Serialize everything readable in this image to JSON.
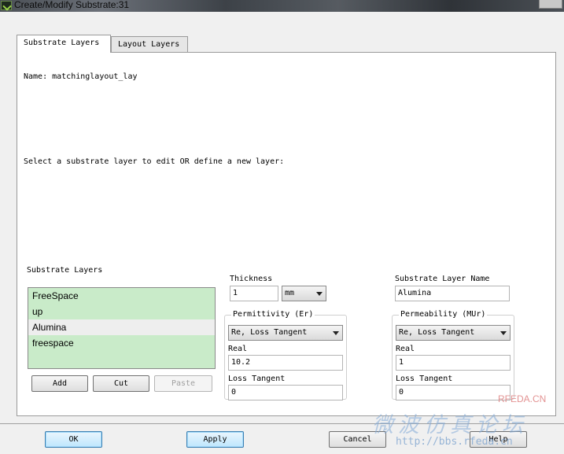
{
  "window": {
    "title": "Create/Modify Substrate:31"
  },
  "tabs": [
    {
      "label": "Substrate Layers",
      "active": true
    },
    {
      "label": "Layout Layers",
      "active": false
    }
  ],
  "panel": {
    "name_line": "Name: matchinglayout_lay",
    "instruction": "Select a substrate layer to edit OR define a new layer:",
    "layers_label": "Substrate Layers",
    "layers": [
      "FreeSpace",
      "up",
      "Alumina",
      "freespace"
    ],
    "selected_layer": "Alumina",
    "list_color": "#c9ebc9",
    "buttons": {
      "add": "Add",
      "cut": "Cut",
      "paste": "Paste"
    },
    "thickness": {
      "label": "Thickness",
      "value": "1",
      "unit": "mm"
    },
    "layer_name": {
      "label": "Substrate Layer Name",
      "value": "Alumina"
    },
    "permittivity": {
      "legend": "Permittivity (Er)",
      "mode": "Re, Loss Tangent",
      "real_label": "Real",
      "real_value": "10.2",
      "loss_label": "Loss Tangent",
      "loss_value": "0"
    },
    "permeability": {
      "legend": "Permeability (MUr)",
      "mode": "Re, Loss Tangent",
      "real_label": "Real",
      "real_value": "1",
      "loss_label": "Loss Tangent",
      "loss_value": "0"
    }
  },
  "footer": {
    "ok": "OK",
    "apply": "Apply",
    "cancel": "Cancel",
    "help": "Help"
  },
  "watermark": {
    "brand": "RFEDA.CN",
    "main": "微波仿真论坛",
    "url": "http://bbs.rfeda.cn"
  }
}
